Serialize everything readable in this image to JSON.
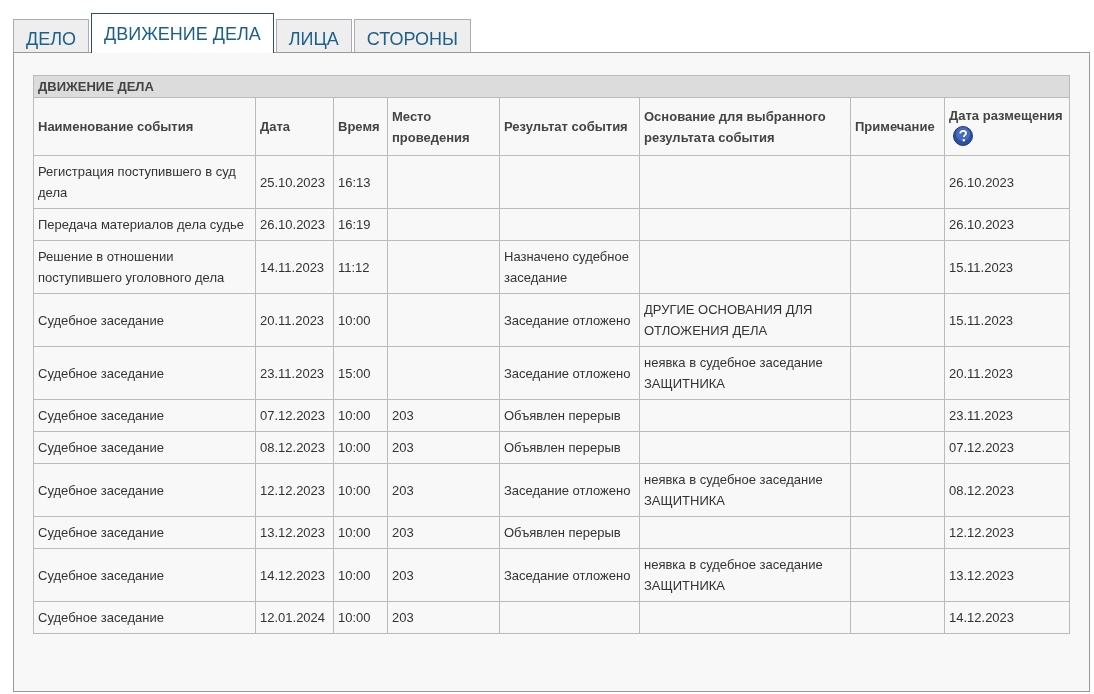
{
  "tabs": [
    {
      "label": "ДЕЛО",
      "selected": false
    },
    {
      "label": "ДВИЖЕНИЕ ДЕЛА",
      "selected": true
    },
    {
      "label": "ЛИЦА",
      "selected": false
    },
    {
      "label": "СТОРОНЫ",
      "selected": false
    }
  ],
  "table": {
    "title": "ДВИЖЕНИЕ ДЕЛА",
    "columns": [
      {
        "label": "Наименование события",
        "help": false
      },
      {
        "label": "Дата",
        "help": false
      },
      {
        "label": "Время",
        "help": false
      },
      {
        "label": "Место проведения",
        "help": false
      },
      {
        "label": "Результат события",
        "help": false
      },
      {
        "label": "Основание для выбранного результата события",
        "help": false
      },
      {
        "label": "Примечание",
        "help": false
      },
      {
        "label": "Дата размещения",
        "help": true
      }
    ],
    "rows": [
      [
        "Регистрация поступившего в суд дела",
        "25.10.2023",
        "16:13",
        null,
        null,
        null,
        null,
        "26.10.2023"
      ],
      [
        "Передача материалов дела судье",
        "26.10.2023",
        "16:19",
        null,
        null,
        null,
        null,
        "26.10.2023"
      ],
      [
        "Решение в отношении поступившего уголовного дела",
        "14.11.2023",
        "11:12",
        null,
        "Назначено судебное заседание",
        null,
        null,
        "15.11.2023"
      ],
      [
        "Судебное заседание",
        "20.11.2023",
        "10:00",
        null,
        "Заседание отложено",
        "ДРУГИЕ ОСНОВАНИЯ ДЛЯ ОТЛОЖЕНИЯ ДЕЛА",
        null,
        "15.11.2023"
      ],
      [
        "Судебное заседание",
        "23.11.2023",
        "15:00",
        null,
        "Заседание отложено",
        "неявка в судебное заседание ЗАЩИТНИКА",
        null,
        "20.11.2023"
      ],
      [
        "Судебное заседание",
        "07.12.2023",
        "10:00",
        "203",
        "Объявлен перерыв",
        null,
        null,
        "23.11.2023"
      ],
      [
        "Судебное заседание",
        "08.12.2023",
        "10:00",
        "203",
        "Объявлен перерыв",
        null,
        null,
        "07.12.2023"
      ],
      [
        "Судебное заседание",
        "12.12.2023",
        "10:00",
        "203",
        "Заседание отложено",
        "неявка в судебное заседание ЗАЩИТНИКА",
        null,
        "08.12.2023"
      ],
      [
        "Судебное заседание",
        "13.12.2023",
        "10:00",
        "203",
        "Объявлен перерыв",
        null,
        null,
        "12.12.2023"
      ],
      [
        "Судебное заседание",
        "14.12.2023",
        "10:00",
        "203",
        "Заседание отложено",
        "неявка в судебное заседание ЗАЩИТНИКА",
        null,
        "13.12.2023"
      ],
      [
        "Судебное заседание",
        "12.01.2024",
        "10:00",
        "203",
        null,
        null,
        null,
        "14.12.2023"
      ]
    ]
  }
}
